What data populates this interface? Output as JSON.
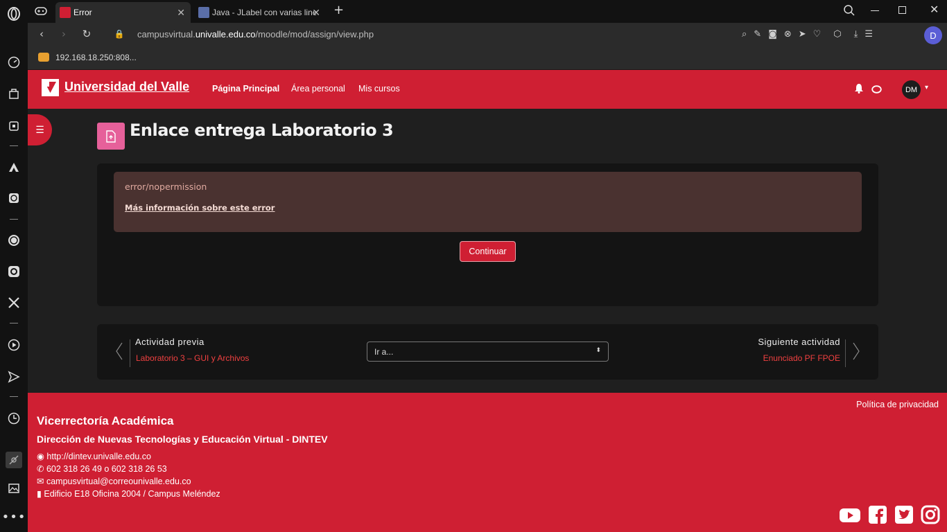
{
  "browser": {
    "tabs": [
      {
        "title": "Error"
      },
      {
        "title": "Java - JLabel con varias line"
      }
    ],
    "url_prefix": "campusvirtual.",
    "url_domain": "univalle.edu.co",
    "url_path": "/moodle/mod/assign/view.php",
    "bookmark": "192.168.18.250:808...",
    "profile_initial": "D"
  },
  "header": {
    "brand": "Universidad del Valle",
    "nav": [
      "Página Principal",
      "Área personal",
      "Mis cursos"
    ],
    "avatar": "DM"
  },
  "page": {
    "title": "Enlace entrega Laboratorio 3",
    "error_code": "error/nopermission",
    "more_info": "Más información sobre este error",
    "continue": "Continuar"
  },
  "activity_nav": {
    "prev_heading": "Actividad previa",
    "prev_link": "Laboratorio 3 – GUI y Archivos",
    "jump_placeholder": "Ir a...",
    "next_heading": "Siguiente actividad",
    "next_link": "Enunciado PF FPOE"
  },
  "footer": {
    "privacy": "Política de privacidad",
    "title": "Vicerrectoría Académica",
    "subtitle": "Dirección de Nuevas Tecnologías y Educación Virtual - DINTEV",
    "website": "http://dintev.univalle.edu.co",
    "phone": "602 318 26 49 o 602 318 26 53",
    "email": "campusvirtual@correounivalle.edu.co",
    "address": "Edificio E18 Oficina 2004 / Campus Meléndez"
  },
  "colors": {
    "brand_red": "#cf1f33",
    "activity_pink": "#e6609a"
  }
}
